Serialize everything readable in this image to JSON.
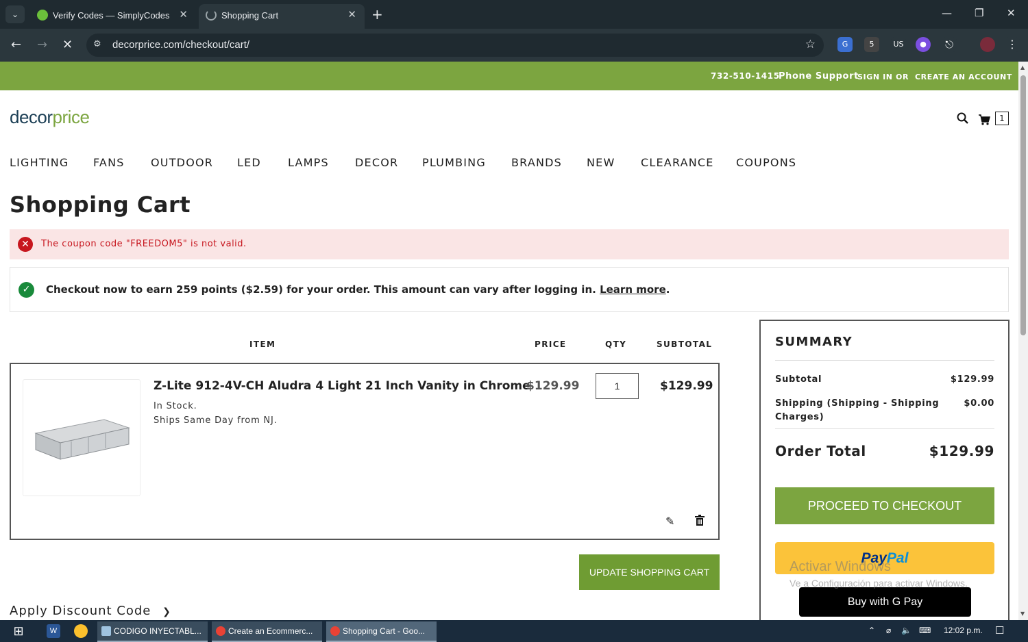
{
  "browser": {
    "tabs": [
      {
        "title": "Verify Codes — SimplyCodes",
        "active": false
      },
      {
        "title": "Shopping Cart",
        "active": true
      }
    ],
    "url": "decorprice.com/checkout/cart/"
  },
  "site": {
    "phone": "732-510-1415",
    "phone_label": "Phone Support",
    "sign_in": "SIGN IN",
    "or": "OR",
    "create_account": "CREATE AN ACCOUNT",
    "logo_part1": "decor",
    "logo_part2": "price",
    "cart_count": "1",
    "menu": [
      "LIGHTING",
      "FANS",
      "OUTDOOR",
      "LED",
      "LAMPS",
      "DECOR",
      "PLUMBING",
      "BRANDS",
      "NEW",
      "CLEARANCE",
      "COUPONS"
    ]
  },
  "cart": {
    "title": "Shopping Cart",
    "error_message": "The coupon code \"FREEDOM5\" is not valid.",
    "points_message": "Checkout now to earn 259 points ($2.59) for your order. This amount can vary after logging in.",
    "learn_more": "Learn more",
    "columns": {
      "item": "ITEM",
      "price": "PRICE",
      "qty": "QTY",
      "subtotal": "SUBTOTAL"
    },
    "item": {
      "name": "Z-Lite 912-4V-CH Aludra 4 Light 21 Inch Vanity in Chrome",
      "stock": "In Stock.",
      "ships": "Ships Same Day from NJ.",
      "price": "$129.99",
      "qty": "1",
      "subtotal": "$129.99"
    },
    "update_button": "UPDATE SHOPPING CART",
    "discount_label": "Apply Discount Code"
  },
  "summary": {
    "title": "SUMMARY",
    "subtotal_label": "Subtotal",
    "subtotal_value": "$129.99",
    "shipping_label_1": "Shipping (Shipping - Shipping",
    "shipping_label_2": "Charges)",
    "shipping_value": "$0.00",
    "order_total_label": "Order Total",
    "order_total_value": "$129.99",
    "checkout_button": "PROCEED TO CHECKOUT",
    "paypal_1": "Pay",
    "paypal_2": "Pal",
    "gpay_button": "Buy with G Pay"
  },
  "watermark": {
    "line1": "Activar Windows",
    "line2": "Ve a Configuración para activar Windows."
  },
  "taskbar": {
    "tasks": [
      "CODIGO INYECTABL...",
      "Create an Ecommerc...",
      "Shopping Cart - Goo..."
    ],
    "time": "12:02 p.m."
  },
  "colors": {
    "green": "#7ca540",
    "error_red": "#c7161e",
    "success_green": "#198a3b"
  }
}
